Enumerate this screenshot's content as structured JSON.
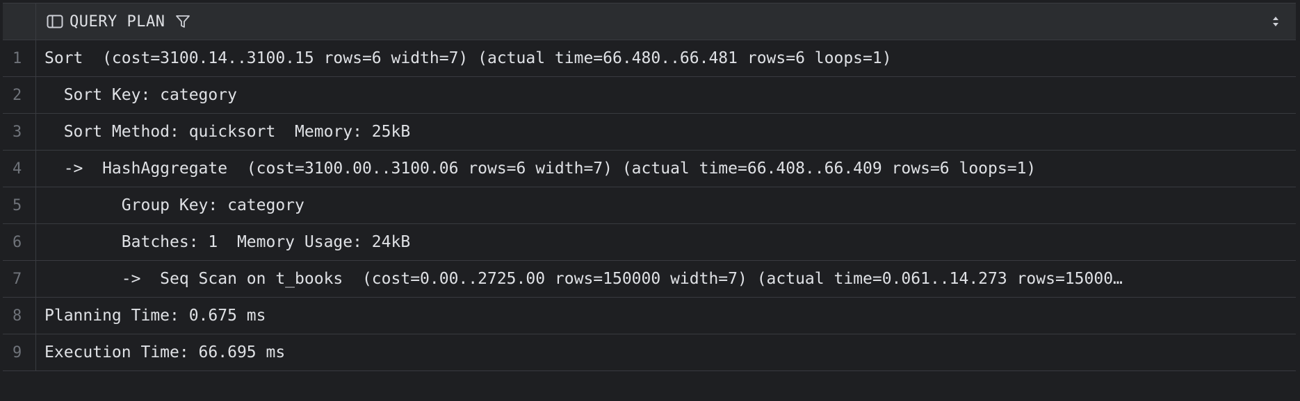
{
  "column": {
    "title": "QUERY PLAN",
    "icons": [
      "panel-icon",
      "filter-icon",
      "sort-toggle-icon"
    ]
  },
  "rows": [
    {
      "num": "1",
      "text": "Sort  (cost=3100.14..3100.15 rows=6 width=7) (actual time=66.480..66.481 rows=6 loops=1)"
    },
    {
      "num": "2",
      "text": "  Sort Key: category"
    },
    {
      "num": "3",
      "text": "  Sort Method: quicksort  Memory: 25kB"
    },
    {
      "num": "4",
      "text": "  ->  HashAggregate  (cost=3100.00..3100.06 rows=6 width=7) (actual time=66.408..66.409 rows=6 loops=1)"
    },
    {
      "num": "5",
      "text": "        Group Key: category"
    },
    {
      "num": "6",
      "text": "        Batches: 1  Memory Usage: 24kB"
    },
    {
      "num": "7",
      "text": "        ->  Seq Scan on t_books  (cost=0.00..2725.00 rows=150000 width=7) (actual time=0.061..14.273 rows=15000…"
    },
    {
      "num": "8",
      "text": "Planning Time: 0.675 ms"
    },
    {
      "num": "9",
      "text": "Execution Time: 66.695 ms"
    }
  ],
  "colors": {
    "background": "#1e1f22",
    "header": "#2b2d30",
    "gridline": "#393b40",
    "text": "#dfe1e5",
    "rownum": "#6f737a"
  }
}
